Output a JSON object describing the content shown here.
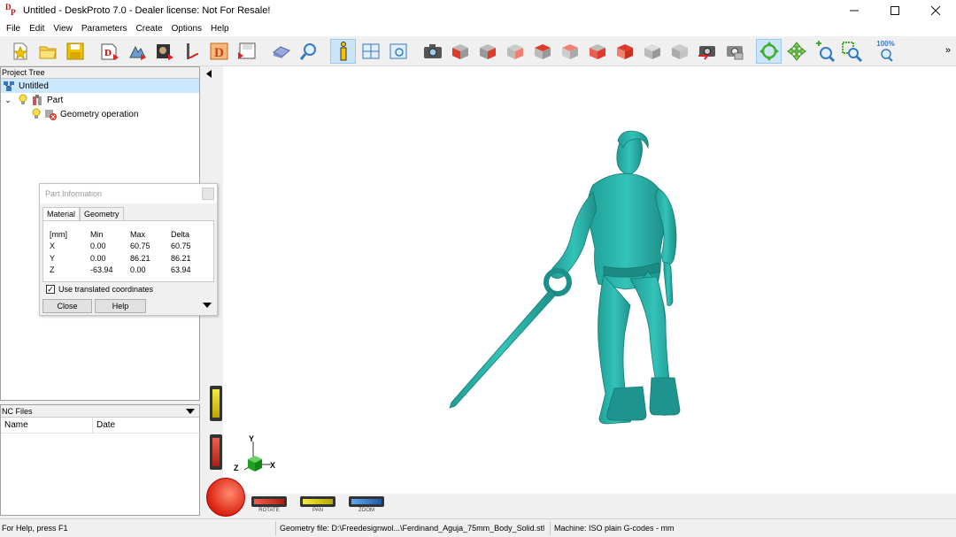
{
  "window": {
    "title": "Untitled - DeskProto 7.0 - Dealer license: Not For Resale!",
    "icon_letters": [
      "D",
      "P"
    ],
    "controls": [
      "minimize-icon",
      "maximize-icon",
      "close-icon"
    ]
  },
  "menu": [
    "File",
    "Edit",
    "View",
    "Parameters",
    "Create",
    "Options",
    "Help"
  ],
  "toolbar": {
    "zoom_label": "100%",
    "overflow": "»",
    "buttons": [
      "new-icon",
      "open-icon",
      "save-icon",
      "wizard-2d-icon",
      "wizard-3d-icon",
      "wizard-image-icon",
      "wizard-vector-icon",
      "wizard-d-icon",
      "save-nc-icon",
      "eraser-icon",
      "magnify-icon",
      "info-icon",
      "layout-icon",
      "preview-icon",
      "camera-icon",
      "view-front-icon",
      "view-back-icon",
      "view-left-icon",
      "view-right-icon",
      "view-top-icon",
      "view-bottom-icon",
      "view-iso-icon",
      "view-gray-icon",
      "view-gray2-icon",
      "camera-red-icon",
      "camera-gray-icon",
      "rotate-mode-icon",
      "pan-mode-icon",
      "zoom-mode-icon",
      "zoom-window-icon",
      "zoom-100-icon"
    ]
  },
  "project_tree": {
    "header": "Project Tree",
    "items": [
      {
        "label": "Untitled"
      },
      {
        "label": "Part"
      },
      {
        "label": "Geometry operation"
      }
    ]
  },
  "nc_files": {
    "header": "NC Files",
    "columns": [
      "Name",
      "Date"
    ]
  },
  "part_info": {
    "title": "Part Information",
    "tabs": [
      "Material",
      "Geometry"
    ],
    "header_row": [
      "[mm]",
      "Min",
      "Max",
      "Delta"
    ],
    "rows": [
      [
        "X",
        "0.00",
        "60.75",
        "60.75"
      ],
      [
        "Y",
        "0.00",
        "86.21",
        "86.21"
      ],
      [
        "Z",
        "-63.94",
        "0.00",
        "63.94"
      ]
    ],
    "checkbox_label": "Use translated coordinates",
    "checkbox_checked": true,
    "close_label": "Close",
    "help_label": "Help"
  },
  "viewport": {
    "model_color": "#2bb5ad",
    "axes": {
      "y": "Y",
      "x": "X",
      "z": "Z"
    },
    "controls": [
      {
        "label": "ROTATE",
        "color": "#e03a2a"
      },
      {
        "label": "PAN",
        "color": "#e8d820"
      },
      {
        "label": "ZOOM",
        "color": "#3c84d8"
      }
    ]
  },
  "status": {
    "help": "For Help, press F1",
    "geometry_file": "Geometry file: D:\\Freedesignwol...\\Ferdinand_Aguja_75mm_Body_Solid.stl",
    "machine": "Machine: ISO plain G-codes - mm"
  }
}
